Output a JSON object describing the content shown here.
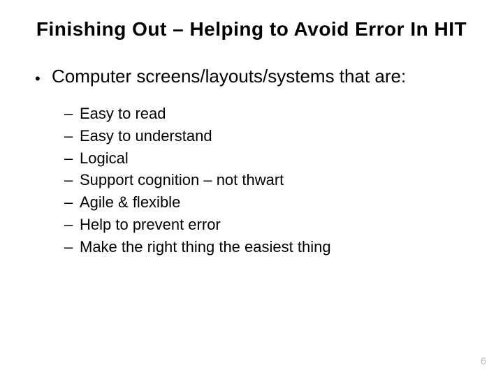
{
  "title": "Finishing Out – Helping to Avoid Error In HIT",
  "bullet": "Computer screens/layouts/systems that are:",
  "subitems": [
    "Easy to read",
    "Easy to understand",
    "Logical",
    "Support cognition – not thwart",
    "Agile & flexible",
    "Help to prevent error",
    "Make the right thing the easiest thing"
  ],
  "page_number": "6"
}
